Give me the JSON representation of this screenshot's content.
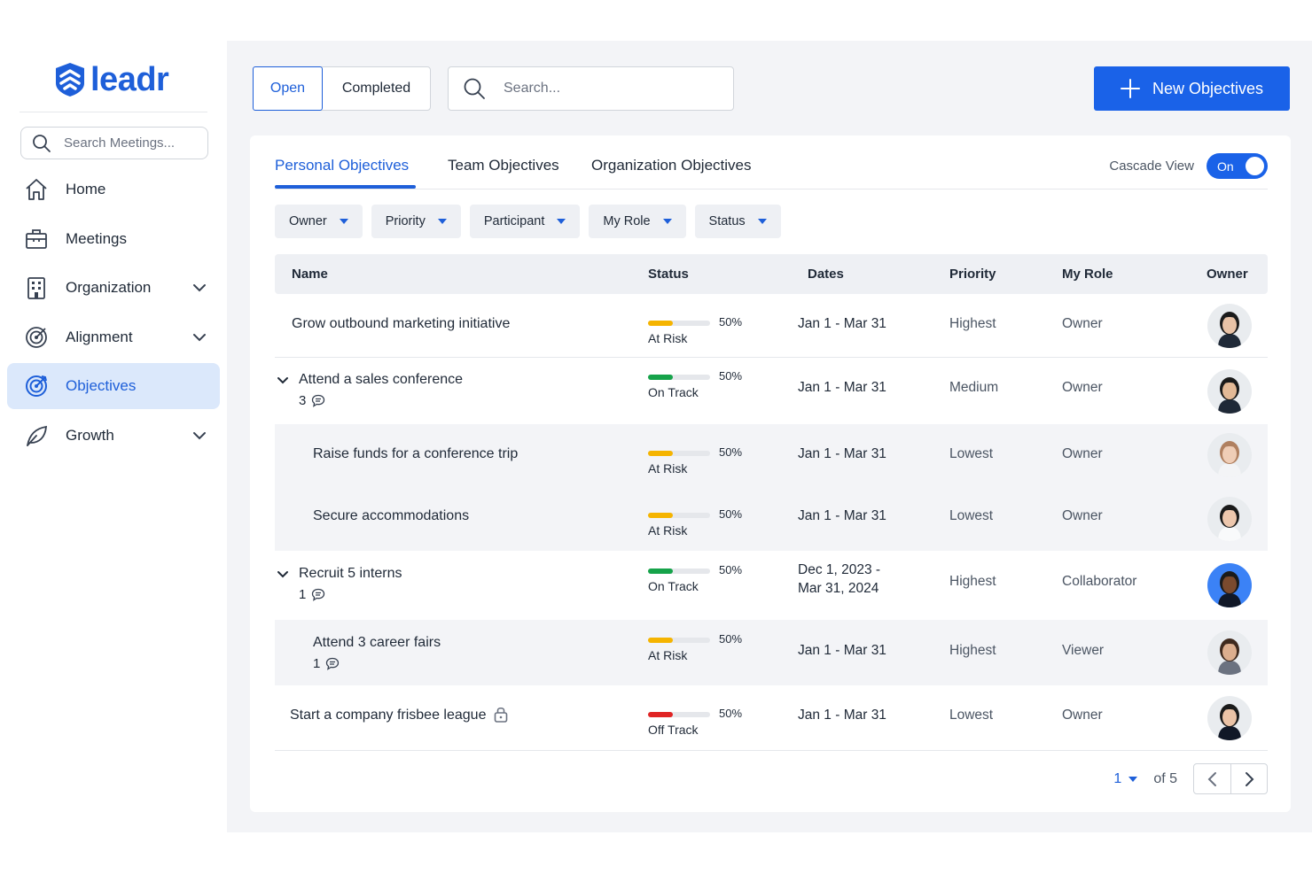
{
  "brand": {
    "name": "leadr",
    "color": "#1e5fd9"
  },
  "sidebar": {
    "search_placeholder": "Search Meetings...",
    "items": [
      {
        "label": "Home",
        "icon": "home-icon",
        "has_chevron": false,
        "active": false
      },
      {
        "label": "Meetings",
        "icon": "briefcase-icon",
        "has_chevron": false,
        "active": false
      },
      {
        "label": "Organization",
        "icon": "building-icon",
        "has_chevron": true,
        "active": false
      },
      {
        "label": "Alignment",
        "icon": "target-icon",
        "has_chevron": true,
        "active": false
      },
      {
        "label": "Objectives",
        "icon": "target-arrow-icon",
        "has_chevron": false,
        "active": true
      },
      {
        "label": "Growth",
        "icon": "leaf-icon",
        "has_chevron": true,
        "active": false
      }
    ]
  },
  "toolbar": {
    "open_label": "Open",
    "completed_label": "Completed",
    "search_placeholder": "Search...",
    "new_button_label": "New Objectives"
  },
  "tabs": [
    {
      "label": "Personal Objectives",
      "active": true
    },
    {
      "label": "Team Objectives",
      "active": false
    },
    {
      "label": "Organization Objectives",
      "active": false
    }
  ],
  "cascade": {
    "label": "Cascade View",
    "toggle_label": "On",
    "on": true
  },
  "filters": [
    "Owner",
    "Priority",
    "Participant",
    "My Role",
    "Status"
  ],
  "table": {
    "columns": [
      "Name",
      "Status",
      "Dates",
      "Priority",
      "My Role",
      "Owner"
    ],
    "rows": [
      {
        "name": "Grow outbound marketing initiative",
        "level": 0,
        "expandable": false,
        "comments": null,
        "locked": false,
        "progress": "50%",
        "progress_value": 0.5,
        "status": "At Risk",
        "status_color": "#f5b400",
        "dates": "Jan 1 - Mar 31",
        "dates_line2": "",
        "priority": "Highest",
        "role": "Owner"
      },
      {
        "name": "Attend a sales conference",
        "level": 0,
        "expandable": true,
        "comments": "3",
        "locked": false,
        "progress": "50%",
        "progress_value": 0.5,
        "status": "On Track",
        "status_color": "#16a34a",
        "dates": "Jan 1 - Mar 31",
        "dates_line2": "",
        "priority": "Medium",
        "role": "Owner"
      },
      {
        "name": "Raise funds for a conference trip",
        "level": 1,
        "expandable": false,
        "comments": null,
        "locked": false,
        "progress": "50%",
        "progress_value": 0.5,
        "status": "At Risk",
        "status_color": "#f5b400",
        "dates": "Jan 1 - Mar 31",
        "dates_line2": "",
        "priority": "Lowest",
        "role": "Owner"
      },
      {
        "name": "Secure accommodations",
        "level": 1,
        "expandable": false,
        "comments": null,
        "locked": false,
        "progress": "50%",
        "progress_value": 0.5,
        "status": "At Risk",
        "status_color": "#f5b400",
        "dates": "Jan 1 - Mar 31",
        "dates_line2": "",
        "priority": "Lowest",
        "role": "Owner"
      },
      {
        "name": "Recruit 5 interns",
        "level": 0,
        "expandable": true,
        "comments": "1",
        "locked": false,
        "progress": "50%",
        "progress_value": 0.5,
        "status": "On Track",
        "status_color": "#16a34a",
        "dates": "Dec 1, 2023 -",
        "dates_line2": "Mar 31, 2024",
        "priority": "Highest",
        "role": "Collaborator"
      },
      {
        "name": "Attend 3 career fairs",
        "level": 1,
        "expandable": false,
        "comments": "1",
        "locked": false,
        "progress": "50%",
        "progress_value": 0.5,
        "status": "At Risk",
        "status_color": "#f5b400",
        "dates": "Jan 1 - Mar 31",
        "dates_line2": "",
        "priority": "Highest",
        "role": "Viewer"
      },
      {
        "name": "Start a company frisbee league",
        "level": 0,
        "expandable": false,
        "comments": null,
        "locked": true,
        "progress": "50%",
        "progress_value": 0.5,
        "status": "Off Track",
        "status_color": "#e02424",
        "dates": "Jan 1 - Mar 31",
        "dates_line2": "",
        "priority": "Lowest",
        "role": "Owner"
      }
    ]
  },
  "pagination": {
    "current": "1",
    "of_label": "of 5"
  }
}
